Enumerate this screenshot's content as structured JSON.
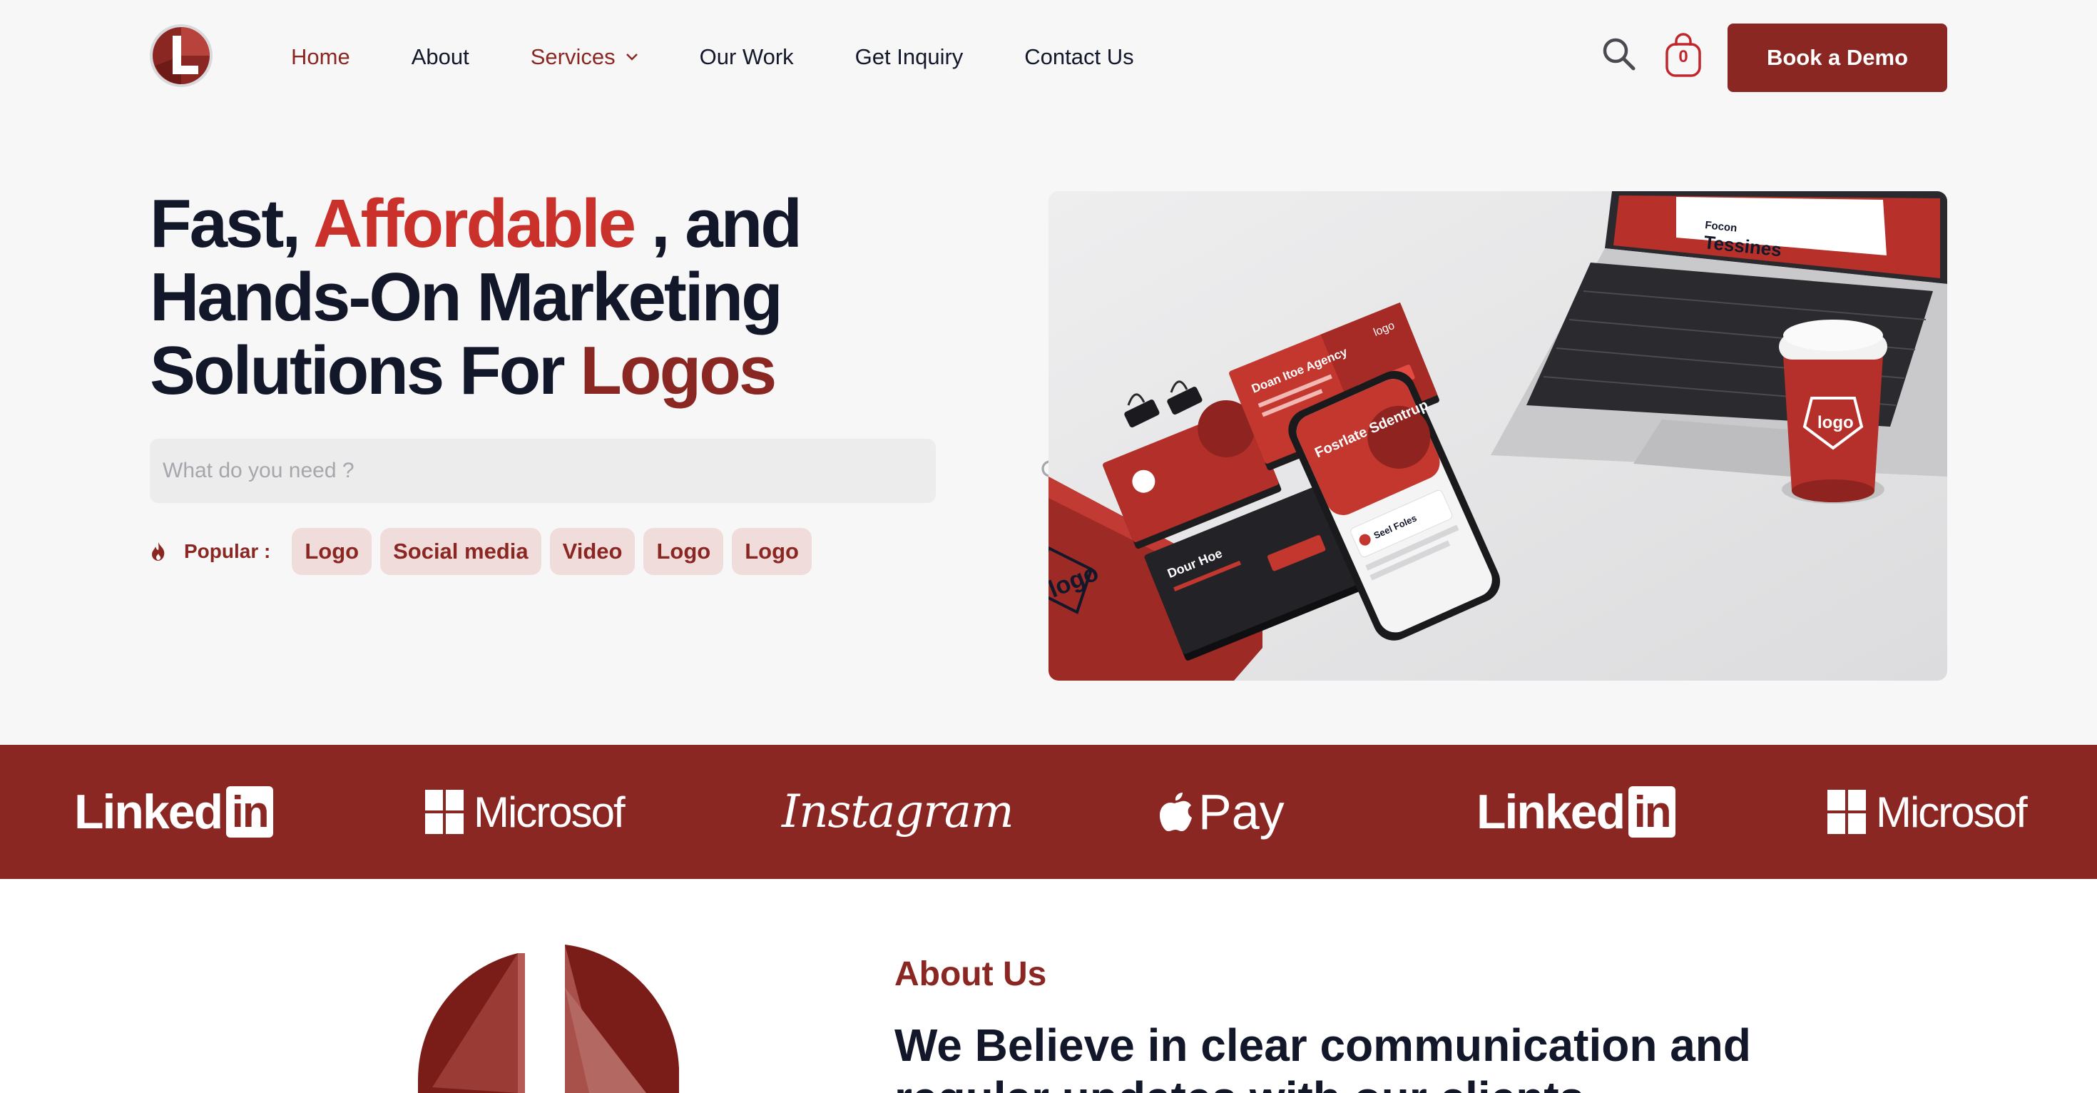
{
  "nav": {
    "items": [
      {
        "label": "Home",
        "active": true
      },
      {
        "label": "About"
      },
      {
        "label": "Services",
        "has_dropdown": true
      },
      {
        "label": "Our Work"
      },
      {
        "label": "Get Inquiry"
      },
      {
        "label": "Contact Us"
      }
    ],
    "cart_count": "0",
    "demo_button": "Book a Demo"
  },
  "hero": {
    "title_parts": {
      "p1": "Fast, ",
      "p2": "Affordable",
      "p3": " , and Hands-On Marketing Solutions For ",
      "p4": "Logos"
    },
    "search_placeholder": "What do you need ?",
    "popular_label": "Popular :",
    "popular_tags": [
      "Logo",
      "Social media",
      "Video",
      "Logo",
      "Logo"
    ]
  },
  "mockup_text": {
    "laptop_heading_1": "Focon",
    "laptop_heading_2": "Tessines",
    "phone_heading": "Fosrlate Sdentrup",
    "phone_item": "Seel Foles",
    "card_1": "Doan Itoe Agency",
    "card_2": "Dour Hoe",
    "card_logo": "logo",
    "cup_logo": "logo",
    "folder_logo": "logo"
  },
  "brands": {
    "linkedin_word": "Linked",
    "linkedin_box": "in",
    "microsoft": "Microsof",
    "instagram": "Instagram",
    "applepay": "Pay"
  },
  "about": {
    "kicker": "About Us",
    "heading": "We Believe in clear communication and regular updates with our clients"
  },
  "colors": {
    "brand": "#8b2722",
    "accent": "#c9312a",
    "chip_bg": "#f0dcdb",
    "text": "#12172a"
  },
  "icons": [
    "logo-icon",
    "chevron-down-icon",
    "search-icon",
    "shopping-bag-icon",
    "fire-icon",
    "microsoft-icon",
    "apple-icon"
  ]
}
